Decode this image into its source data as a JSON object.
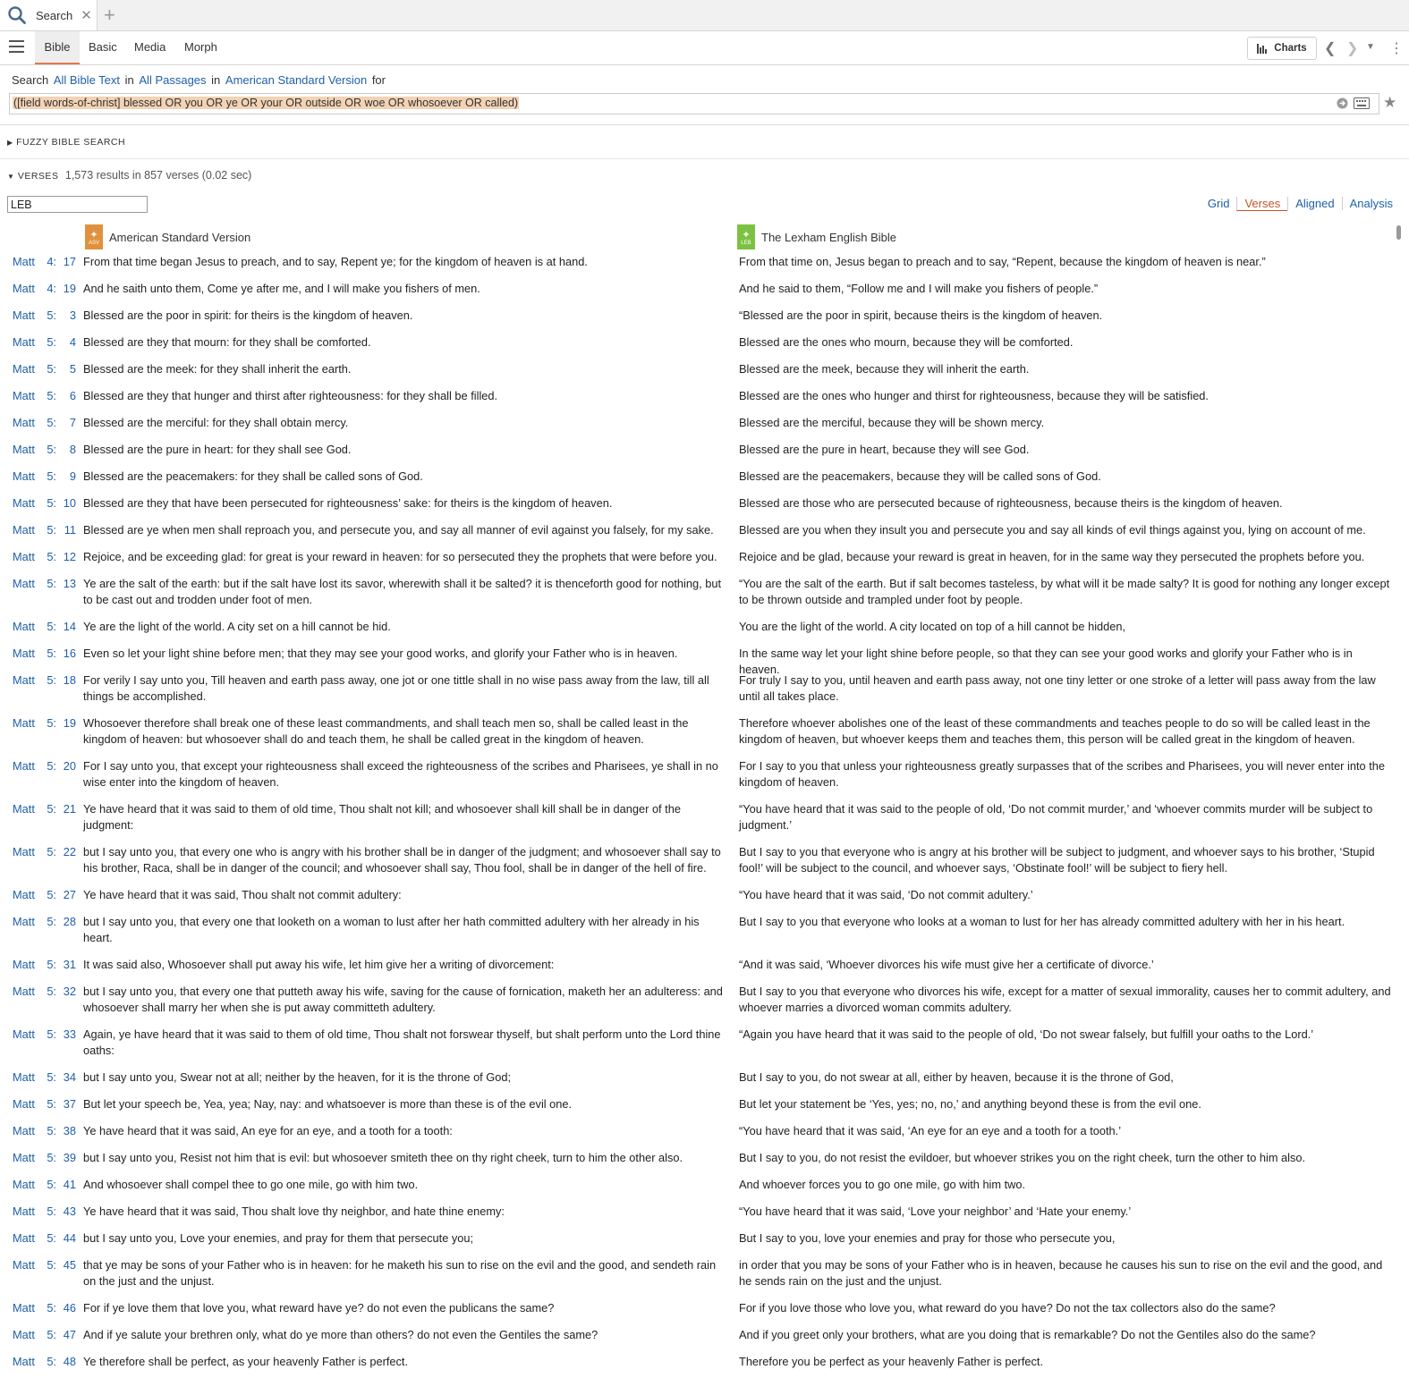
{
  "tab": {
    "title": "Search"
  },
  "subtabs": [
    "Bible",
    "Basic",
    "Media",
    "Morph"
  ],
  "toolbar": {
    "charts_label": "Charts"
  },
  "scope": {
    "prefix": "Search",
    "text": "All Bible Text",
    "in1": "in",
    "passages": "All Passages",
    "in2": "in",
    "version": "American Standard Version",
    "for": "for"
  },
  "query": "([field words-of-christ] blessed OR you OR ye OR your OR outside OR woe OR whosoever OR called)",
  "fuzzy_label": "FUZZY BIBLE SEARCH",
  "verses_label": "VERSES",
  "result_count": "1,573 results in 857 verses (0.02 sec)",
  "filter_value": "LEB",
  "view_tabs": [
    "Grid",
    "Verses",
    "Aligned",
    "Analysis"
  ],
  "active_view": "Verses",
  "columns": {
    "left": "American Standard Version",
    "right": "The Lexham English Bible",
    "left_abbr": "ASV",
    "right_abbr": "LEB"
  },
  "colors": {
    "accent": "#e07a4f",
    "link": "#1f5fa8",
    "hl_orange": "#f6d7c3",
    "hl_yellow": "#fbeab8",
    "hl_blue": "#d8e6f4",
    "hl_green": "#eef3d3"
  },
  "verses": [
    {
      "book": "Matt",
      "ch": "4:",
      "v": "17",
      "asv": "From that time began Jesus to preach, and to say, Repent ye; for the kingdom of heaven is at hand.",
      "leb": "From that time on, Jesus began to preach and to say, “Repent, because the kingdom of heaven is near.”"
    },
    {
      "book": "Matt",
      "ch": "4:",
      "v": "19",
      "asv": "And he saith unto them, Come ye after me, and I will make you fishers of men.",
      "leb": "And he said to them, “Follow me and I will make you fishers of people.”"
    },
    {
      "book": "Matt",
      "ch": "5:",
      "v": "3",
      "asv": "Blessed are the poor in spirit: for theirs is the kingdom of heaven.",
      "leb": "“Blessed are the poor in spirit, because theirs is the kingdom of heaven."
    },
    {
      "book": "Matt",
      "ch": "5:",
      "v": "4",
      "asv": "Blessed are they that mourn: for they shall be comforted.",
      "leb": "Blessed are the ones who mourn, because they will be comforted."
    },
    {
      "book": "Matt",
      "ch": "5:",
      "v": "5",
      "asv": "Blessed are the meek: for they shall inherit the earth.",
      "leb": "Blessed are the meek, because they will inherit the earth."
    },
    {
      "book": "Matt",
      "ch": "5:",
      "v": "6",
      "asv": "Blessed are they that hunger and thirst after righteousness: for they shall be filled.",
      "leb": "Blessed are the ones who hunger and thirst for righteousness, because they will be satisfied."
    },
    {
      "book": "Matt",
      "ch": "5:",
      "v": "7",
      "asv": "Blessed are the merciful: for they shall obtain mercy.",
      "leb": "Blessed are the merciful, because they will be shown mercy."
    },
    {
      "book": "Matt",
      "ch": "5:",
      "v": "8",
      "asv": "Blessed are the pure in heart: for they shall see God.",
      "leb": "Blessed are the pure in heart, because they will see God."
    },
    {
      "book": "Matt",
      "ch": "5:",
      "v": "9",
      "asv": "Blessed are the peacemakers: for they shall be called sons of God.",
      "leb": "Blessed are the peacemakers, because they will be called sons of God."
    },
    {
      "book": "Matt",
      "ch": "5:",
      "v": "10",
      "asv": "Blessed are they that have been persecuted for righteousness’ sake: for theirs is the kingdom of heaven.",
      "leb": "Blessed are those who are persecuted because of righteousness, because theirs is the kingdom of heaven."
    },
    {
      "book": "Matt",
      "ch": "5:",
      "v": "11",
      "asv": "Blessed are ye when men shall reproach you, and persecute you, and say all manner of evil against you falsely, for my sake.",
      "leb": "Blessed are you when they insult you and persecute you and say all kinds of evil things against you, lying on account of me."
    },
    {
      "book": "Matt",
      "ch": "5:",
      "v": "12",
      "asv": "Rejoice, and be exceeding glad: for great is your reward in heaven: for so persecuted they the prophets that were before you.",
      "leb": "Rejoice and be glad, because your reward is great in heaven, for in the same way they persecuted the prophets before you."
    },
    {
      "book": "Matt",
      "ch": "5:",
      "v": "13",
      "asv": "Ye are the salt of the earth: but if the salt have lost its savor, wherewith shall it be salted? it is thenceforth good for nothing, but to be cast out and trodden under foot of men.",
      "leb": "“You are the salt of the earth. But if salt becomes tasteless, by what will it be made salty? It is good for nothing any longer except to be thrown outside and trampled under foot by people."
    },
    {
      "book": "Matt",
      "ch": "5:",
      "v": "14",
      "asv": "Ye are the light of the world. A city set on a hill cannot be hid.",
      "leb": "You are the light of the world. A city located on top of a hill cannot be hidden,"
    },
    {
      "book": "Matt",
      "ch": "5:",
      "v": "16",
      "asv": "Even so let your light shine before men; that they may see your good works, and glorify your Father who is in heaven.",
      "leb": "In the same way let your light shine before people, so that they can see your good works and glorify your Father who is in heaven."
    },
    {
      "book": "Matt",
      "ch": "5:",
      "v": "18",
      "asv": "For verily I say unto you, Till heaven and earth pass away, one jot or one tittle shall in no wise pass away from the law, till all things be accomplished.",
      "leb": "For truly I say to you, until heaven and earth pass away, not one tiny letter or one stroke of a letter will pass away from the law until all takes place."
    },
    {
      "book": "Matt",
      "ch": "5:",
      "v": "19",
      "asv": "Whosoever therefore shall break one of these least commandments, and shall teach men so, shall be called least in the kingdom of heaven: but whosoever shall do and teach them, he shall be called great in the kingdom of heaven.",
      "leb": "Therefore whoever abolishes one of the least of these commandments and teaches people to do so will be called least in the kingdom of heaven, but whoever keeps them and teaches them, this person will be called great in the kingdom of heaven."
    },
    {
      "book": "Matt",
      "ch": "5:",
      "v": "20",
      "asv": "For I say unto you, that except your righteousness shall exceed the righteousness of the scribes and Pharisees, ye shall in no wise enter into the kingdom of heaven.",
      "leb": "For I say to you that unless your righteousness greatly surpasses that of the scribes and Pharisees, you will never enter into the kingdom of heaven."
    },
    {
      "book": "Matt",
      "ch": "5:",
      "v": "21",
      "asv": "Ye have heard that it was said to them of old time, Thou shalt not kill; and whosoever shall kill shall be in danger of the judgment:",
      "leb": "“You have heard that it was said to the people of old, ‘Do not commit murder,’ and ‘whoever commits murder will be subject to judgment.’"
    },
    {
      "book": "Matt",
      "ch": "5:",
      "v": "22",
      "asv": "but I say unto you, that every one who is angry with his brother shall be in danger of the judgment; and whosoever shall say to his brother, Raca, shall be in danger of the council; and whosoever shall say, Thou fool, shall be in danger of the hell of fire.",
      "leb": "But I say to you that everyone who is angry at his brother will be subject to judgment, and whoever says to his brother, ‘Stupid fool!’ will be subject to the council, and whoever says, ‘Obstinate fool!’ will be subject to fiery hell."
    },
    {
      "book": "Matt",
      "ch": "5:",
      "v": "27",
      "asv": "Ye have heard that it was said, Thou shalt not commit adultery:",
      "leb": "“You have heard that it was said, ‘Do not commit adultery.’"
    },
    {
      "book": "Matt",
      "ch": "5:",
      "v": "28",
      "asv": "but I say unto you, that every one that looketh on a woman to lust after her hath committed adultery with her already in his heart.",
      "leb": "But I say to you that everyone who looks at a woman to lust for her has already committed adultery with her in his heart."
    },
    {
      "book": "Matt",
      "ch": "5:",
      "v": "31",
      "asv": "It was said also, Whosoever shall put away his wife, let him give her a writing of divorcement:",
      "leb": "“And it was said, ‘Whoever divorces his wife must give her a certificate of divorce.’"
    },
    {
      "book": "Matt",
      "ch": "5:",
      "v": "32",
      "asv": "but I say unto you, that every one that putteth away his wife, saving for the cause of fornication, maketh her an adulteress: and whosoever shall marry her when she is put away committeth adultery.",
      "leb": "But I say to you that everyone who divorces his wife, except for a matter of sexual immorality, causes her to commit adultery, and whoever marries a divorced woman commits adultery."
    },
    {
      "book": "Matt",
      "ch": "5:",
      "v": "33",
      "asv": "Again, ye have heard that it was said to them of old time, Thou shalt not forswear thyself, but shalt perform unto the Lord thine oaths:",
      "leb": "“Again you have heard that it was said to the people of old, ‘Do not swear falsely, but fulfill your oaths to the Lord.’"
    },
    {
      "book": "Matt",
      "ch": "5:",
      "v": "34",
      "asv": "but I say unto you, Swear not at all; neither by the heaven, for it is the throne of God;",
      "leb": "But I say to you, do not swear at all, either by heaven, because it is the throne of God,"
    },
    {
      "book": "Matt",
      "ch": "5:",
      "v": "37",
      "asv": "But let your speech be, Yea, yea; Nay, nay: and whatsoever is more than these is of the evil one.",
      "leb": "But let your statement be ‘Yes, yes; no, no,’ and anything beyond these is from the evil one."
    },
    {
      "book": "Matt",
      "ch": "5:",
      "v": "38",
      "asv": "Ye have heard that it was said, An eye for an eye, and a tooth for a tooth:",
      "leb": "“You have heard that it was said, ‘An eye for an eye and a tooth for a tooth.’"
    },
    {
      "book": "Matt",
      "ch": "5:",
      "v": "39",
      "asv": "but I say unto you, Resist not him that is evil: but whosoever smiteth thee on thy right cheek, turn to him the other also.",
      "leb": "But I say to you, do not resist the evildoer, but whoever strikes you on the right cheek, turn the other to him also."
    },
    {
      "book": "Matt",
      "ch": "5:",
      "v": "41",
      "asv": "And whosoever shall compel thee to go one mile, go with him two.",
      "leb": "And whoever forces you to go one mile, go with him two."
    },
    {
      "book": "Matt",
      "ch": "5:",
      "v": "43",
      "asv": "Ye have heard that it was said, Thou shalt love thy neighbor, and hate thine enemy:",
      "leb": "“You have heard that it was said, ‘Love your neighbor’ and ‘Hate your enemy.’"
    },
    {
      "book": "Matt",
      "ch": "5:",
      "v": "44",
      "asv": "but I say unto you, Love your enemies, and pray for them that persecute you;",
      "leb": "But I say to you, love your enemies and pray for those who persecute you,"
    },
    {
      "book": "Matt",
      "ch": "5:",
      "v": "45",
      "asv": "that ye may be sons of your Father who is in heaven: for he maketh his sun to rise on the evil and the good, and sendeth rain on the just and the unjust.",
      "leb": "in order that you may be sons of your Father who is in heaven, because he causes his sun to rise on the evil and the good, and he sends rain on the just and the unjust."
    },
    {
      "book": "Matt",
      "ch": "5:",
      "v": "46",
      "asv": "For if ye love them that love you, what reward have ye? do not even the publicans the same?",
      "leb": "For if you love those who love you, what reward do you have? Do not the tax collectors also do the same?"
    },
    {
      "book": "Matt",
      "ch": "5:",
      "v": "47",
      "asv": "And if ye salute your brethren only, what do ye more than others? do not even the Gentiles the same?",
      "leb": "And if you greet only your brothers, what are you doing that is remarkable? Do not the Gentiles also do the same?"
    },
    {
      "book": "Matt",
      "ch": "5:",
      "v": "48",
      "asv": "Ye therefore shall be perfect, as your heavenly Father is perfect.",
      "leb": "Therefore you be perfect as your heavenly Father is perfect."
    }
  ]
}
